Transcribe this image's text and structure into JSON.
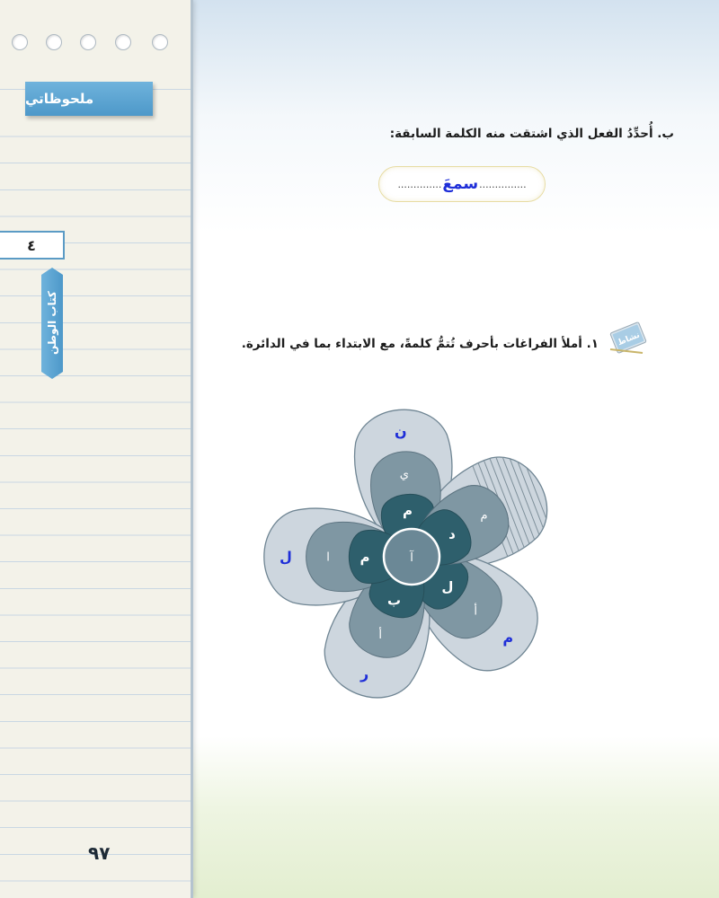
{
  "sidebar": {
    "notes_label": "ملحوظاتي",
    "unit_number": "٤",
    "unit_title": "كتاب الوطن",
    "page_number": "٩٧"
  },
  "question_b": {
    "label": "ب.",
    "text": "أُحدِّدُ الفعل الذي اشتقت منه الكلمة السابقة:",
    "dots_before": "..............",
    "answer": "سمعَ",
    "dots_after": "..............."
  },
  "question_1": {
    "icon": "notebook-write-icon",
    "icon_text": "نشاط",
    "number": "١.",
    "text": "أملأ الفراغات بأحرف تُتمُّ كلمةً، مع الابتداء بما في الدائرة."
  },
  "flower": {
    "center_letter": "آ",
    "colors": {
      "outer": "#cdd6de",
      "middle": "#7f97a3",
      "inner": "#2e5f6c",
      "center": "#6b8896",
      "user_letter": "#1e2ed8"
    },
    "petals": [
      {
        "name": "up",
        "inner": "م",
        "middle": "ي",
        "outer": "ن"
      },
      {
        "name": "upper-right",
        "inner": "د",
        "middle": "م",
        "outer": ""
      },
      {
        "name": "lower-right",
        "inner": "ل",
        "middle": "أ",
        "outer": "م"
      },
      {
        "name": "down",
        "inner": "ب",
        "middle": "أ",
        "outer": "ر"
      },
      {
        "name": "left",
        "inner": "م",
        "middle": "ا",
        "outer": "ل"
      }
    ]
  }
}
